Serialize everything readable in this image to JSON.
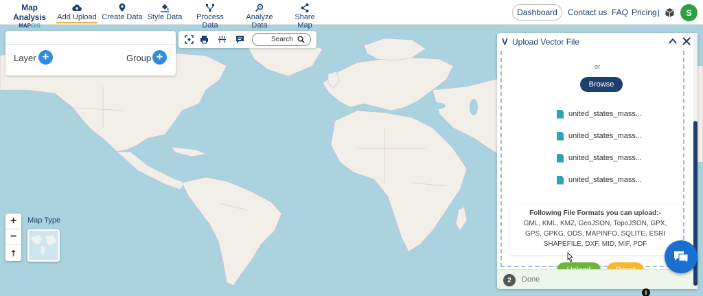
{
  "brand": {
    "line1": "Map Analysis",
    "line2_a": "MAP",
    "line2_b": "GIS"
  },
  "nav": {
    "items": [
      {
        "label": "Add Upload",
        "icon": "cloud-upload-icon",
        "active": true
      },
      {
        "label": "Create Data",
        "icon": "map-pin-icon"
      },
      {
        "label": "Style Data",
        "icon": "paint-bucket-icon"
      },
      {
        "label": "Process Data",
        "icon": "process-icon"
      },
      {
        "label": "Analyze Data",
        "icon": "analyze-icon"
      },
      {
        "label": "Share Map",
        "icon": "share-icon"
      }
    ],
    "dashboard": "Dashboard",
    "contact": "Contact us",
    "faq": "FAQ",
    "pricing": "Pricing",
    "pricing_sep": "|",
    "avatar": "S"
  },
  "layer_panel": {
    "layer_label": "Layer",
    "group_label": "Group",
    "plus": "+"
  },
  "map_tools": {
    "search_label": "Search"
  },
  "zoom": {
    "in": "+",
    "out": "−",
    "reset": "⇡"
  },
  "map_type": {
    "label": "Map Type"
  },
  "upload_panel": {
    "title": "Upload Vector File",
    "or_text": "or",
    "browse": "Browse",
    "files": [
      "united_states_mass...",
      "united_states_mass...",
      "united_states_mass...",
      "united_states_mass..."
    ],
    "formats_heading": "Following File Formats you can upload:-",
    "formats_lines": [
      "GML, KML, KMZ, GeoJSON, TopoJSON, GPX,",
      "GPS, GPKG, ODS, MAPINFO, SQLITE, ESRI",
      "SHAPEFILE, DXF, MID, MIF, PDF"
    ],
    "upload": "Upload",
    "reset": "Reset",
    "step_number": "2",
    "step_label": "Done"
  },
  "info": "i",
  "colors": {
    "brand": "#1d3f6e",
    "accent_blue": "#2d8de0",
    "upload_green": "#6db33f",
    "reset_yellow": "#f5b82e",
    "water": "#aad3df",
    "land": "#f2efe9"
  }
}
